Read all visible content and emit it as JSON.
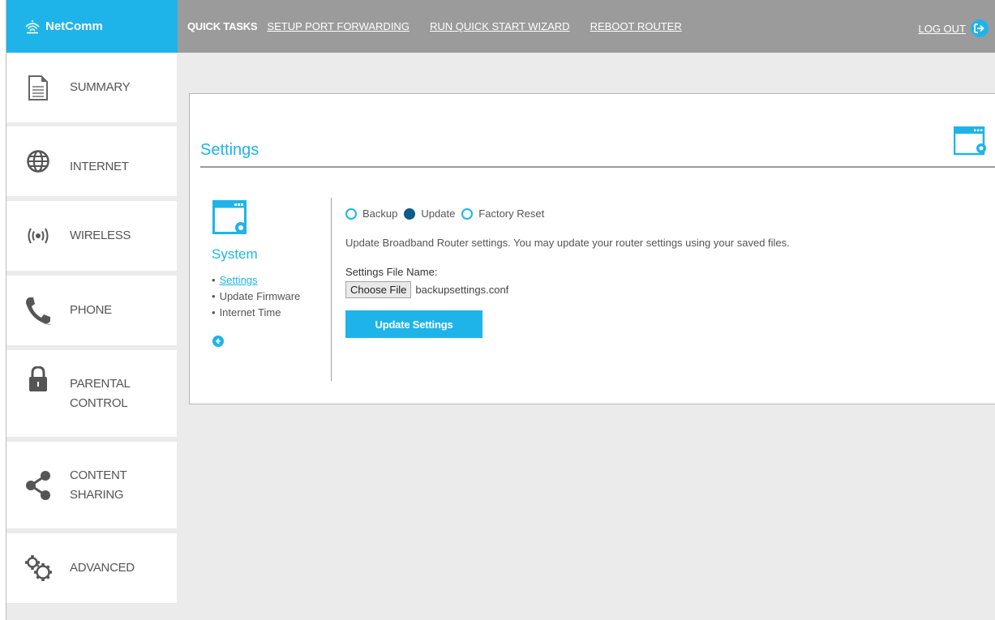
{
  "brand": {
    "name": "NetComm"
  },
  "topbar": {
    "quick_tasks": "QUICK TASKS",
    "links": [
      "SETUP PORT FORWARDING",
      "RUN QUICK START WIZARD",
      "REBOOT ROUTER"
    ],
    "logout": "LOG OUT"
  },
  "sidebar": {
    "items": [
      {
        "label": "SUMMARY",
        "icon": "document-icon"
      },
      {
        "label": "INTERNET",
        "icon": "globe-icon"
      },
      {
        "label": "WIRELESS",
        "icon": "wireless-icon"
      },
      {
        "label": "PHONE",
        "icon": "phone-icon"
      },
      {
        "label_line1": "PARENTAL",
        "label_line2": "CONTROL",
        "icon": "lock-icon"
      },
      {
        "label_line1": "CONTENT",
        "label_line2": "SHARING",
        "icon": "share-icon"
      },
      {
        "label": "ADVANCED",
        "icon": "gears-icon"
      }
    ]
  },
  "page": {
    "title": "Settings",
    "section_title": "System",
    "submenu": [
      "Settings",
      "Update Firmware",
      "Internet Time"
    ],
    "radios": [
      {
        "label": "Backup",
        "selected": false
      },
      {
        "label": "Update",
        "selected": true
      },
      {
        "label": "Factory Reset",
        "selected": false
      }
    ],
    "description": "Update Broadband Router settings. You may update your router settings using your saved files.",
    "file_label": "Settings File Name:",
    "choose_file": "Choose File",
    "file_name": "backupsettings.conf",
    "submit": "Update Settings"
  },
  "colors": {
    "accent": "#1eb4e9",
    "topbar": "#9b9b9b",
    "background": "#ecebeb",
    "radio_selected": "#0d5a8c"
  }
}
